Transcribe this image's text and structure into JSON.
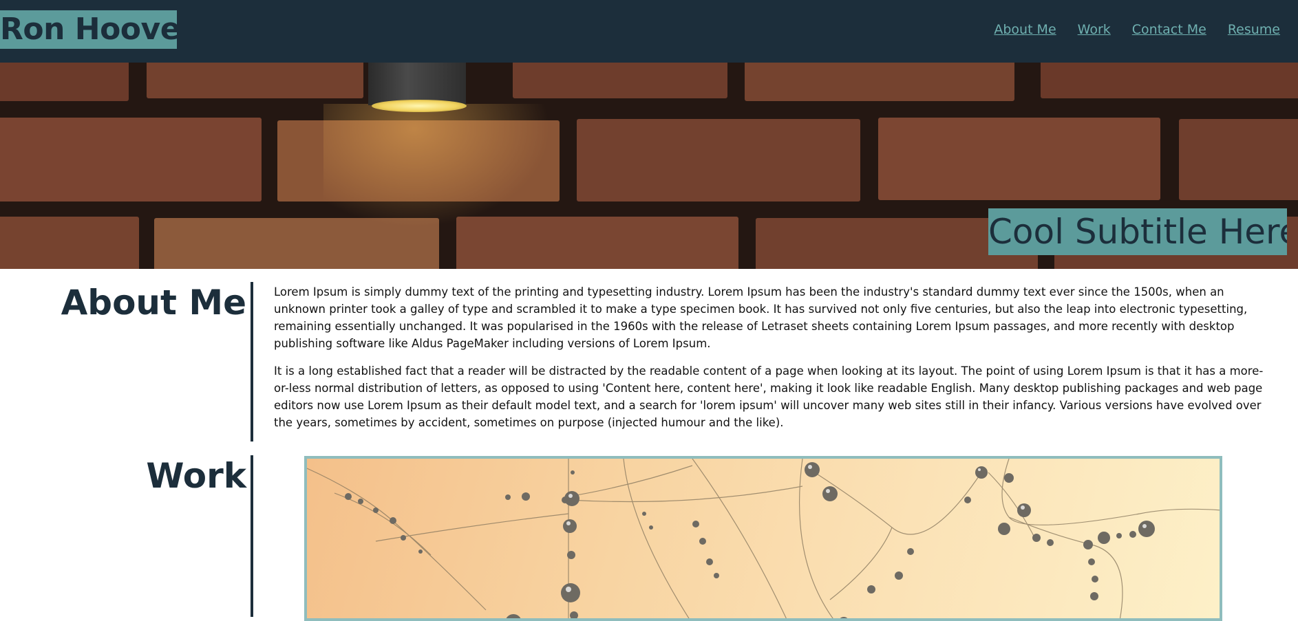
{
  "header": {
    "site_title": "Ron Hoover",
    "nav": [
      {
        "label": "About Me"
      },
      {
        "label": "Work"
      },
      {
        "label": "Contact Me"
      },
      {
        "label": "Resume"
      }
    ]
  },
  "hero": {
    "subtitle": "Cool Subtitle Here!"
  },
  "about": {
    "heading": "About Me",
    "paragraphs": [
      "Lorem Ipsum is simply dummy text of the printing and typesetting industry. Lorem Ipsum has been the industry's standard dummy text ever since the 1500s, when an unknown printer took a galley of type and scrambled it to make a type specimen book. It has survived not only five centuries, but also the leap into electronic typesetting, remaining essentially unchanged. It was popularised in the 1960s with the release of Letraset sheets containing Lorem Ipsum passages, and more recently with desktop publishing software like Aldus PageMaker including versions of Lorem Ipsum.",
      "It is a long established fact that a reader will be distracted by the readable content of a page when looking at its layout. The point of using Lorem Ipsum is that it has a more-or-less normal distribution of letters, as opposed to using 'Content here, content here', making it look like readable English. Many desktop publishing packages and web page editors now use Lorem Ipsum as their default model text, and a search for 'lorem ipsum' will uncover many web sites still in their infancy. Various versions have evolved over the years, sometimes by accident, sometimes on purpose (injected humour and the like)."
    ]
  },
  "work": {
    "heading": "Work"
  },
  "colors": {
    "header_bg": "#1c2e3b",
    "accent_teal": "#5c9b9b",
    "link": "#6fb0b0",
    "frame_border": "#8fbdbd"
  }
}
